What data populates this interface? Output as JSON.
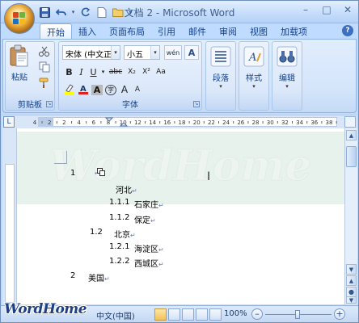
{
  "app": {
    "title": "文档 2 - Microsoft Word"
  },
  "window_controls": {
    "minimize": "–",
    "maximize": "□",
    "close": "✕"
  },
  "quick_access": [
    {
      "icon": "save-icon",
      "glyph": "💾"
    },
    {
      "icon": "undo-icon",
      "glyph": "↶"
    },
    {
      "icon": "redo-icon",
      "glyph": "↻"
    },
    {
      "icon": "new-document-icon",
      "glyph": "▯"
    },
    {
      "icon": "open-folder-icon",
      "glyph": "▭"
    },
    {
      "icon": "customize-dropdown-icon",
      "glyph": "▾"
    }
  ],
  "tabs": [
    {
      "label": "开始",
      "active": true
    },
    {
      "label": "插入",
      "active": false
    },
    {
      "label": "页面布局",
      "active": false
    },
    {
      "label": "引用",
      "active": false
    },
    {
      "label": "邮件",
      "active": false
    },
    {
      "label": "审阅",
      "active": false
    },
    {
      "label": "视图",
      "active": false
    },
    {
      "label": "加载项",
      "active": false
    }
  ],
  "ribbon": {
    "clipboard": {
      "group_label": "剪贴板",
      "paste_label": "粘贴"
    },
    "font": {
      "group_label": "字体",
      "font_name": "宋体 (中文正文)",
      "font_size": "小五",
      "wen_glyph": "wén",
      "bold": "B",
      "italic": "I",
      "underline": "U",
      "strike": "abc",
      "subscript": "X₂",
      "superscript": "X²",
      "change_case": "Aa",
      "char_border": "A",
      "enclose": "字",
      "grow": "A",
      "shrink": "A"
    },
    "paragraph": {
      "label": "段落"
    },
    "styles": {
      "label": "样式"
    },
    "editing": {
      "label": "编辑"
    }
  },
  "ruler": {
    "numbers": [
      "4",
      "2",
      "2",
      "4",
      "6",
      "8",
      "10",
      "12",
      "14",
      "16",
      "18",
      "20",
      "22",
      "24",
      "26",
      "28",
      "30",
      "32",
      "34",
      "36",
      "38"
    ]
  },
  "document": {
    "lines": [
      {
        "number": "1",
        "text": ""
      },
      {
        "number": "",
        "text": "河北"
      },
      {
        "number": "1.1.1",
        "text": "石家庄"
      },
      {
        "number": "1.1.2",
        "text": "保定"
      },
      {
        "number": "1.2",
        "text": "北京"
      },
      {
        "number": "1.2.1",
        "text": "海淀区"
      },
      {
        "number": "1.2.2",
        "text": "西城区"
      },
      {
        "number": "2",
        "text": "美国"
      }
    ],
    "paragraph_mark": "↵"
  },
  "status": {
    "language": "中文(中国)",
    "zoom": "100%"
  },
  "watermark": {
    "brand": "WordHome"
  },
  "colors": {
    "accent": "#15428b",
    "ribbon": "#dbe8fa",
    "title": "#c4dcfb"
  }
}
